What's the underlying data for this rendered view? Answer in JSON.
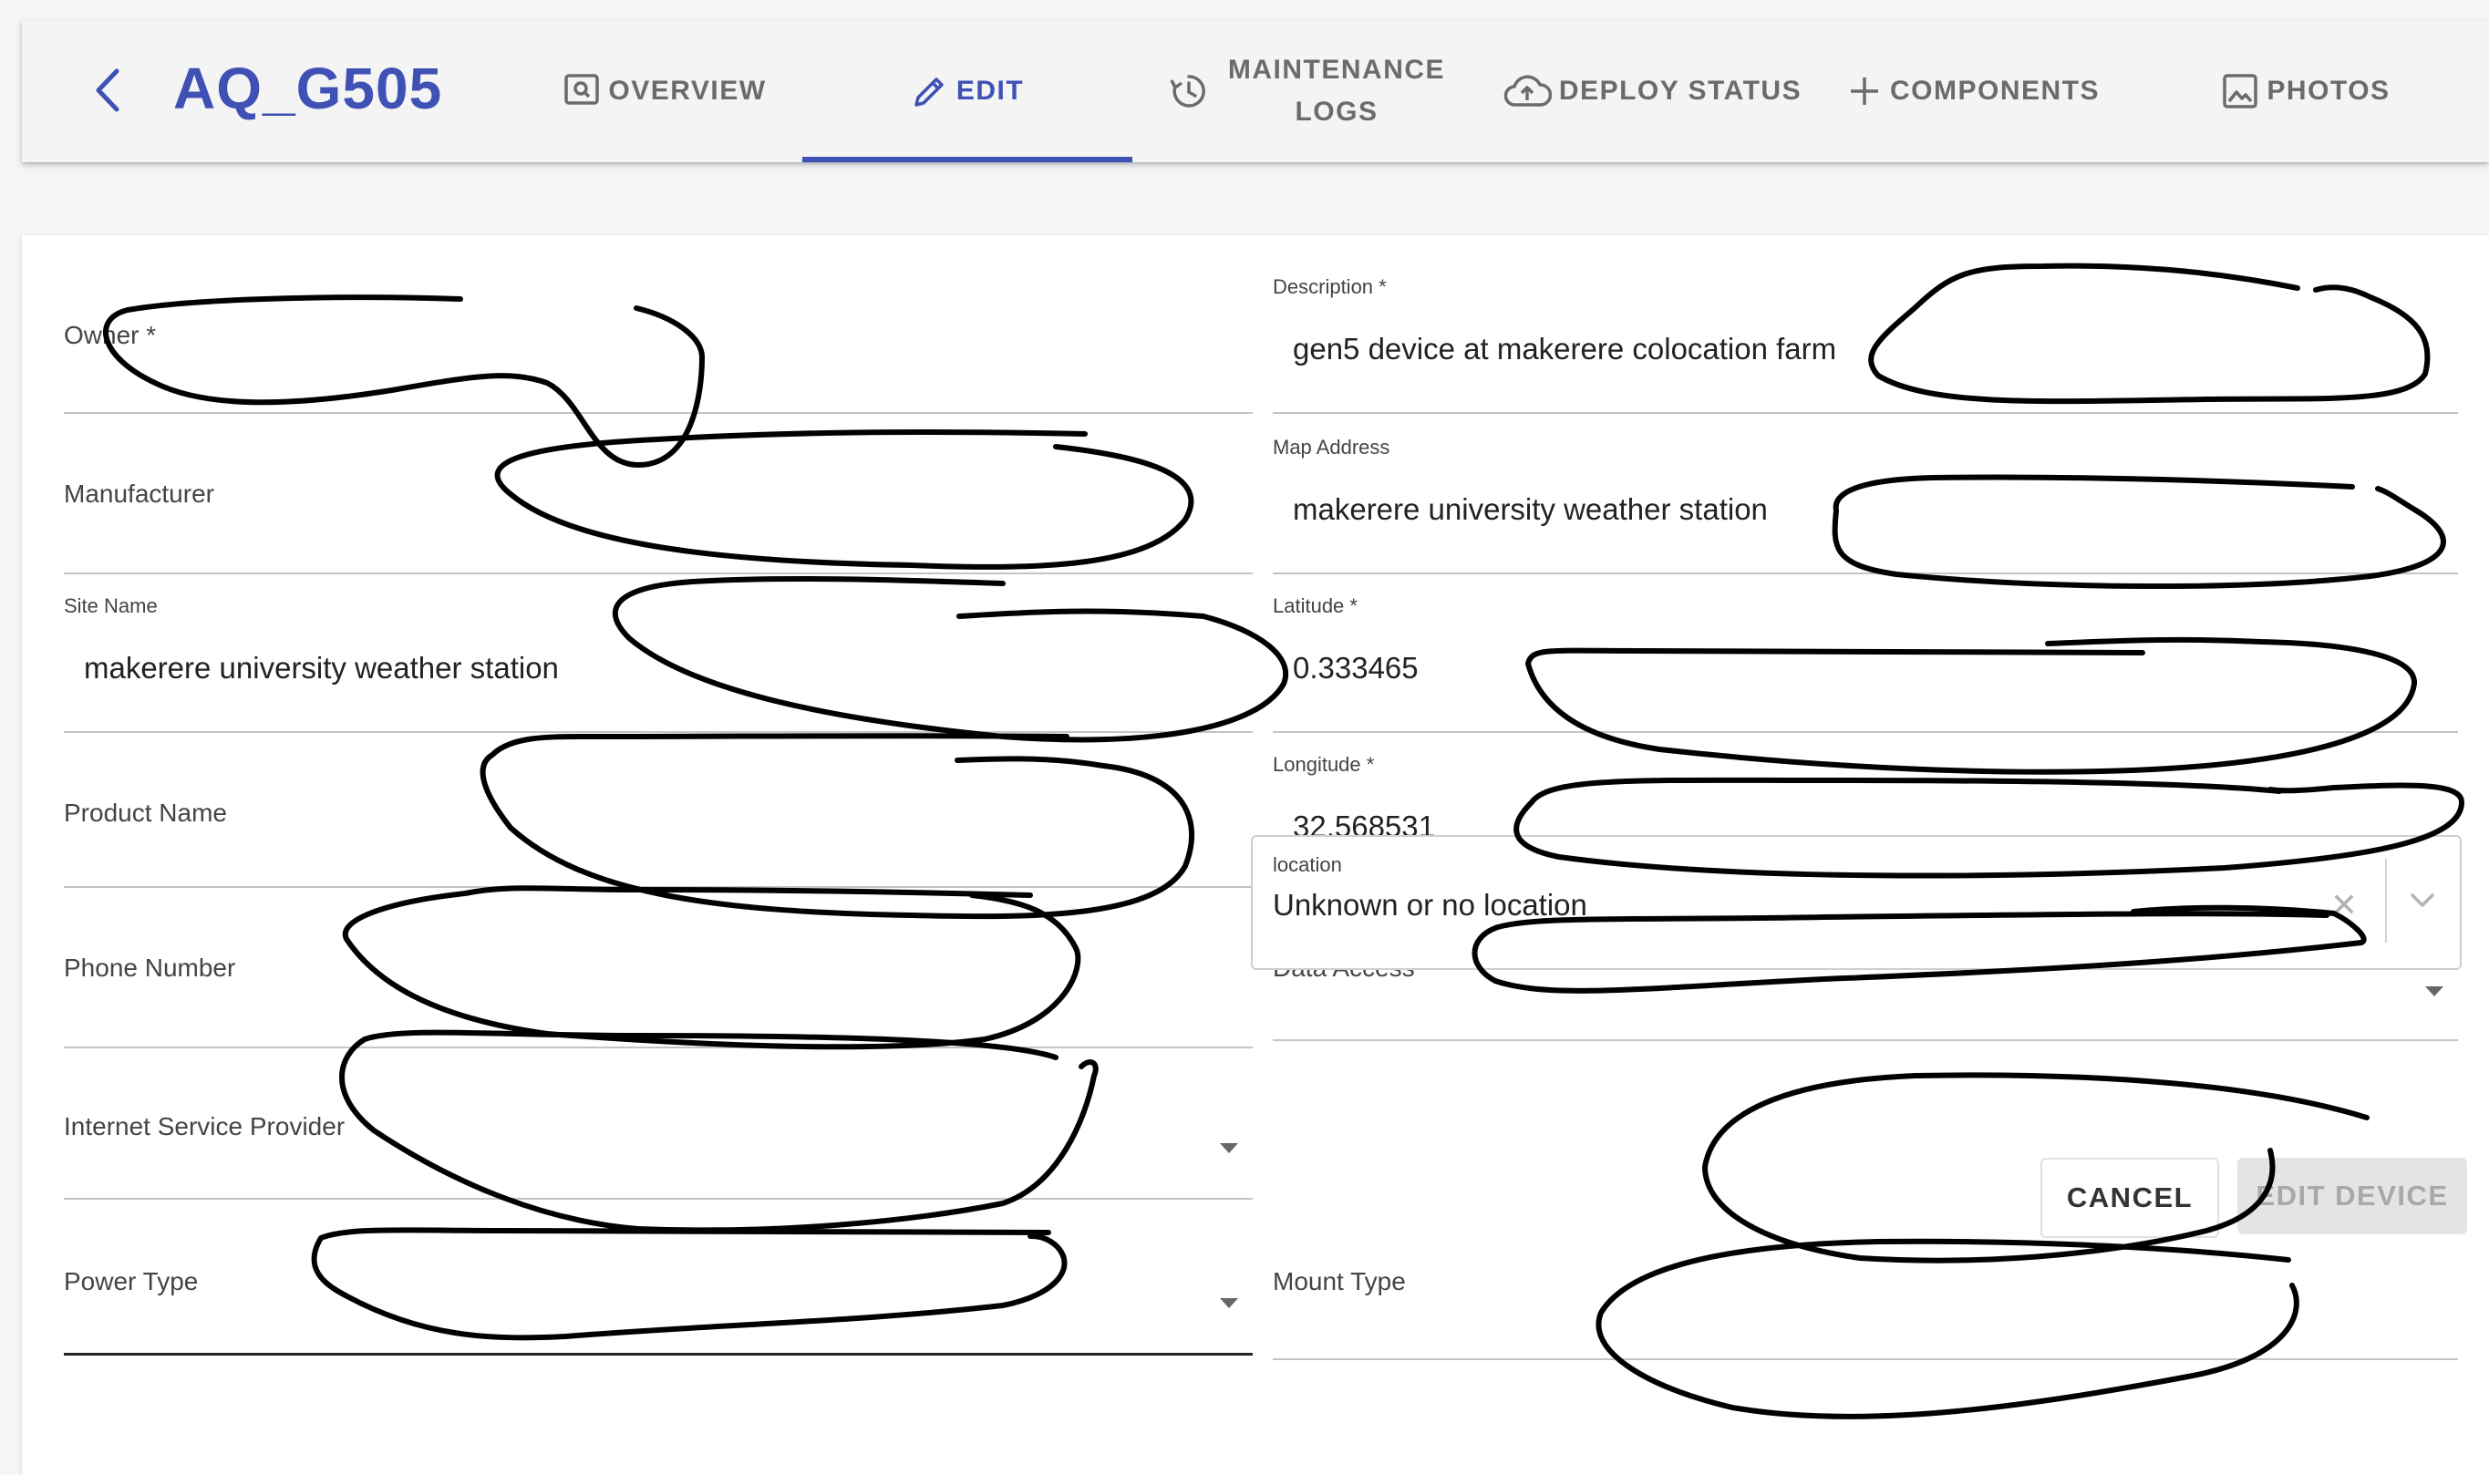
{
  "header": {
    "device_name": "AQ_G505",
    "tabs": [
      {
        "label": "OVERVIEW",
        "icon": "preview-icon"
      },
      {
        "label": "EDIT",
        "icon": "pencil-icon"
      },
      {
        "label_line1": "MAINTENANCE",
        "label_line2": "LOGS",
        "icon": "history-icon"
      },
      {
        "label": "DEPLOY STATUS",
        "icon": "cloud-upload-icon"
      },
      {
        "label": "COMPONENTS",
        "icon": "plus-icon"
      },
      {
        "label": "PHOTOS",
        "icon": "image-icon"
      }
    ],
    "active_tab": "EDIT",
    "accent_color": "#3f51b5"
  },
  "form": {
    "owner_label": "Owner *",
    "manufacturer_label": "Manufacturer",
    "site_name_label": "Site Name",
    "site_name_value": "makerere university weather station",
    "product_name_label": "Product Name",
    "phone_number_label": "Phone Number",
    "isp_label": "Internet Service Provider",
    "power_type_label": "Power Type",
    "description_label": "Description *",
    "description_value": "gen5 device at makerere colocation farm",
    "map_address_label": "Map Address",
    "map_address_value": "makerere university weather station",
    "latitude_label": "Latitude *",
    "latitude_value": "0.333465",
    "longitude_label": "Longitude *",
    "longitude_value": "32.568531",
    "data_access_label": "Data Access *",
    "location_label": "location",
    "location_value": "Unknown or no location",
    "mount_type_label": "Mount Type"
  },
  "actions": {
    "cancel_label": "CANCEL",
    "edit_device_label": "EDIT DEVICE"
  }
}
